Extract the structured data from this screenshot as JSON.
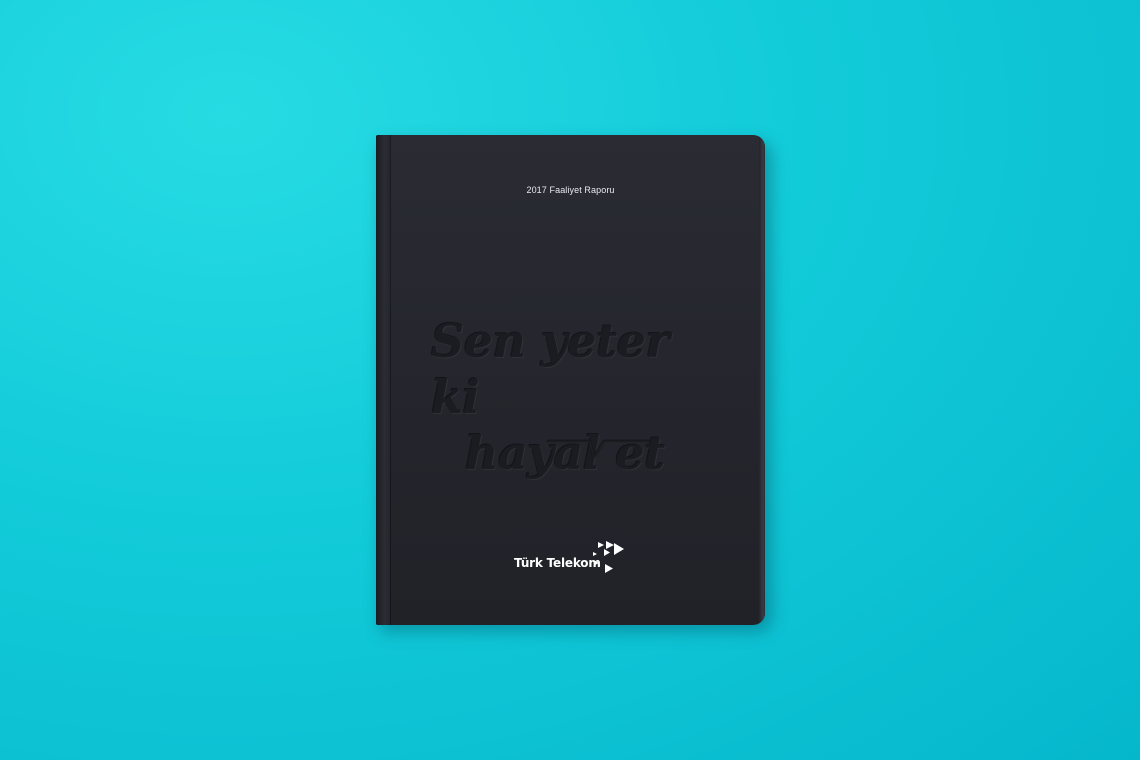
{
  "cover": {
    "report_title": "2017 Faaliyet Raporu",
    "slogan_line1": "Sen yeter ki",
    "slogan_line2": "hayal et",
    "brand_name": "Türk Telekom"
  },
  "colors": {
    "background": "#12cbd9",
    "cover": "#24252c",
    "text_light": "#ffffff"
  },
  "icons": [
    "speech-bubble-tail-icon",
    "play-arrows-logo-icon"
  ]
}
